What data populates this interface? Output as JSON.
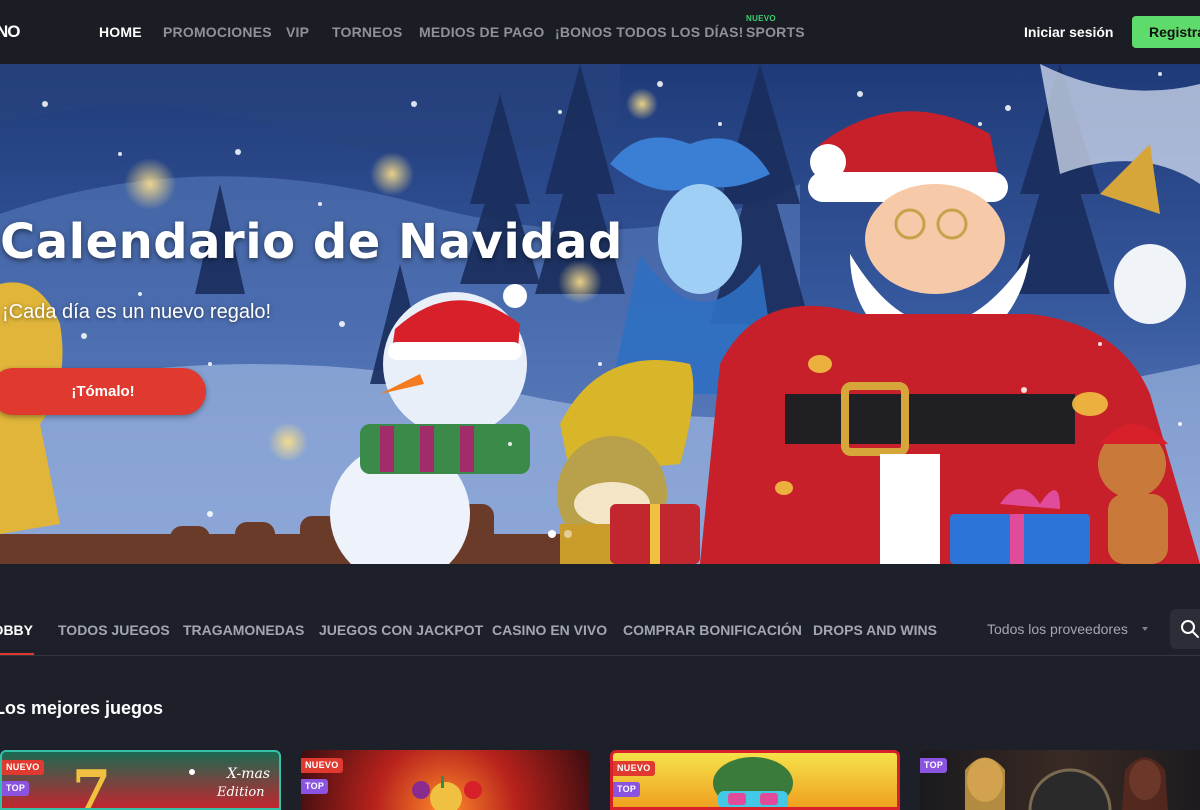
{
  "header": {
    "logo": "NO",
    "nav": [
      {
        "label": "HOME",
        "active": true
      },
      {
        "label": "PROMOCIONES"
      },
      {
        "label": "VIP"
      },
      {
        "label": "TORNEOS"
      },
      {
        "label": "MEDIOS DE PAGO"
      },
      {
        "label": "¡BONOS TODOS LOS DÍAS!"
      },
      {
        "label": "SPORTS",
        "badge": "NUEVO"
      }
    ],
    "login_label": "Iniciar sesión",
    "register_label": "Registrarse"
  },
  "hero": {
    "title": "Calendario de Navidad",
    "subtitle": "¡Cada día es un nuevo regalo!",
    "cta_label": "¡Tómalo!",
    "slides_count": 2,
    "active_slide": 1
  },
  "tabs": {
    "items": [
      {
        "label": "LOBBY",
        "active": true
      },
      {
        "label": "TODOS JUEGOS"
      },
      {
        "label": "TRAGAMONEDAS"
      },
      {
        "label": "JUEGOS CON JACKPOT"
      },
      {
        "label": "CASINO EN VIVO"
      },
      {
        "label": "COMPRAR BONIFICACIÓN"
      },
      {
        "label": "DROPS AND WINS"
      }
    ],
    "provider_label": "Todos los proveedores",
    "search_icon": "search-icon"
  },
  "section": {
    "title": "Los mejores juegos"
  },
  "games": [
    {
      "badges": [
        "NUEVO",
        "TOP"
      ],
      "art_text": "X-mas Edition"
    },
    {
      "badges": [
        "NUEVO",
        "TOP"
      ]
    },
    {
      "badges": [
        "NUEVO",
        "TOP"
      ]
    },
    {
      "badges": [
        "TOP"
      ]
    }
  ],
  "colors": {
    "accent_red": "#e0392f",
    "register_green": "#5fdb6b",
    "nuevo_badge": "#e0392f",
    "top_badge": "#8a54e0",
    "header_bg": "#1b1d24",
    "page_bg": "#1e2029"
  }
}
